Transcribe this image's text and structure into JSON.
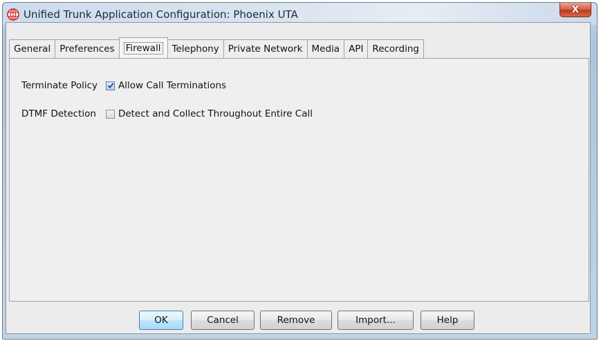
{
  "window": {
    "title": "Unified Trunk Application Configuration: Phoenix UTA",
    "close_label": "X",
    "accent_close": "#c7432a"
  },
  "tabs": [
    {
      "label": "General",
      "active": false
    },
    {
      "label": "Preferences",
      "active": false
    },
    {
      "label": "Firewall",
      "active": true
    },
    {
      "label": "Telephony",
      "active": false
    },
    {
      "label": "Private Network",
      "active": false
    },
    {
      "label": "Media",
      "active": false
    },
    {
      "label": "API",
      "active": false
    },
    {
      "label": "Recording",
      "active": false
    }
  ],
  "firewall": {
    "terminate_policy": {
      "label": "Terminate Policy",
      "checkbox_label": "Allow Call Terminations",
      "checked": true
    },
    "dtmf_detection": {
      "label": "DTMF Detection",
      "checkbox_label": "Detect and Collect Throughout Entire Call",
      "checked": false
    }
  },
  "buttons": {
    "ok": "OK",
    "cancel": "Cancel",
    "remove": "Remove",
    "import": "Import...",
    "help": "Help"
  },
  "icons": {
    "app": "globe-icon",
    "check": "checkmark-icon"
  }
}
